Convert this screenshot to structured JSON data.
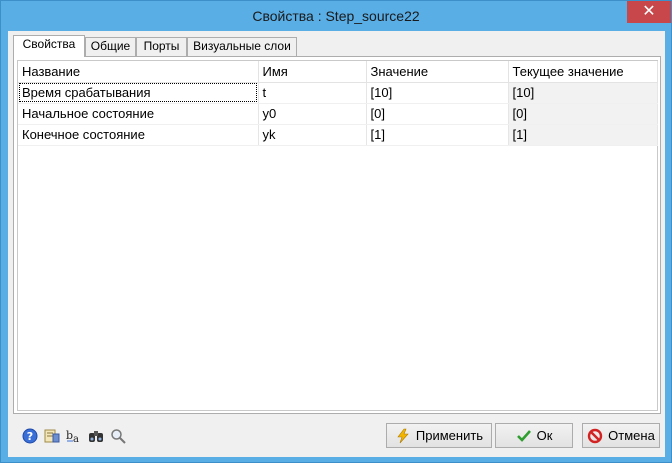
{
  "window": {
    "title": "Свойства : Step_source22",
    "close_glyph": "✕"
  },
  "tabs": [
    {
      "label": "Свойства",
      "active": true
    },
    {
      "label": "Общие",
      "active": false
    },
    {
      "label": "Порты",
      "active": false
    },
    {
      "label": "Визуальные слои",
      "active": false
    }
  ],
  "table": {
    "columns": [
      "Название",
      "Имя",
      "Значение",
      "Текущее значение"
    ],
    "rows": [
      {
        "name": "Время срабатывания",
        "id": "t",
        "value": "[10]",
        "current": "[10]"
      },
      {
        "name": "Начальное состояние",
        "id": "y0",
        "value": "[0]",
        "current": "[0]"
      },
      {
        "name": "Конечное состояние",
        "id": "yk",
        "value": "[1]",
        "current": "[1]"
      }
    ]
  },
  "toolbar_icons": [
    "help-icon",
    "edit-properties-icon",
    "rename-icon",
    "binoculars-icon",
    "magnifier-icon"
  ],
  "buttons": {
    "apply": "Применить",
    "ok": "Ок",
    "cancel": "Отмена"
  },
  "colors": {
    "titlebar": "#5aaee6",
    "close": "#c7474a",
    "ok_check": "#2e9e2e",
    "cancel_red": "#d22222"
  }
}
